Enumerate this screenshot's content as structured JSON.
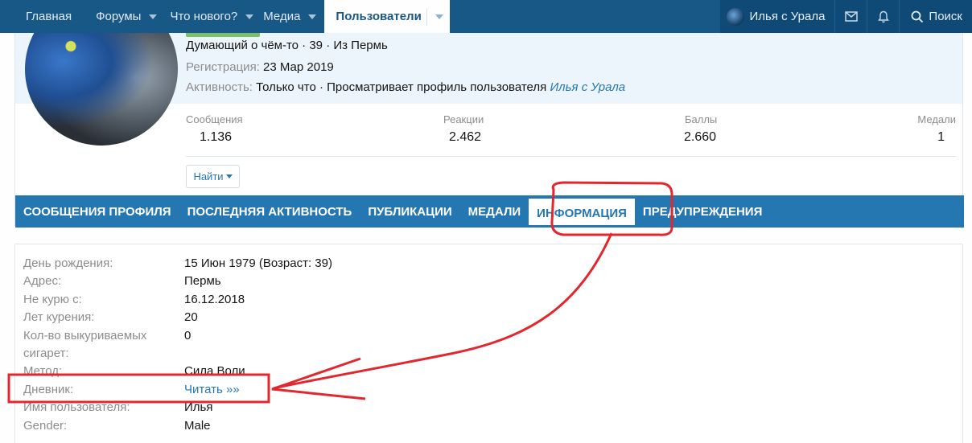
{
  "nav": {
    "items": [
      {
        "label": "Главная",
        "caret": false
      },
      {
        "label": "Форумы",
        "caret": true
      },
      {
        "label": "Что нового?",
        "caret": true
      },
      {
        "label": "Медиа",
        "caret": true
      }
    ],
    "active": "Пользователи",
    "user": "Илья с Урала",
    "search": "Поиск"
  },
  "profile": {
    "line1": "Думающий о чём-то · 39 · Из Пермь",
    "registration_label": "Регистрация:",
    "registration_value": "23 Мар 2019",
    "activity_label": "Активность:",
    "activity_value": "Только что · Просматривает профиль пользователя",
    "activity_link": "Илья с Урала",
    "stats": [
      {
        "label": "Сообщения",
        "value": "1.136"
      },
      {
        "label": "Реакции",
        "value": "2.462"
      },
      {
        "label": "Баллы",
        "value": "2.660"
      },
      {
        "label": "Медали",
        "value": "1"
      }
    ],
    "find_button": "Найти"
  },
  "tabs": [
    "СООБЩЕНИЯ ПРОФИЛЯ",
    "ПОСЛЕДНЯЯ АКТИВНОСТЬ",
    "ПУБЛИКАЦИИ",
    "МЕДАЛИ",
    "ИНФОРМАЦИЯ",
    "ПРЕДУПРЕЖДЕНИЯ"
  ],
  "info": [
    {
      "key": "День рождения:",
      "value": "15 Июн 1979 (Возраст: 39)"
    },
    {
      "key": "Адрес:",
      "value": "Пермь"
    },
    {
      "key": "Не курю с:",
      "value": "16.12.2018"
    },
    {
      "key": "Лет курения:",
      "value": "20"
    },
    {
      "key": "Кол-во выкуриваемых",
      "value": "0"
    },
    {
      "key": "сигарет:",
      "value": ""
    },
    {
      "key": "Метод:",
      "value": "Сила Воли"
    },
    {
      "key": "Дневник:",
      "value": "Читать »»"
    },
    {
      "key": "Имя пользователя:",
      "value": "Илья"
    },
    {
      "key": "Gender:",
      "value": "Male"
    }
  ],
  "colors": {
    "nav_bg": "#185886",
    "tab_bg": "#2577b1",
    "annotation": "#e0282e"
  }
}
